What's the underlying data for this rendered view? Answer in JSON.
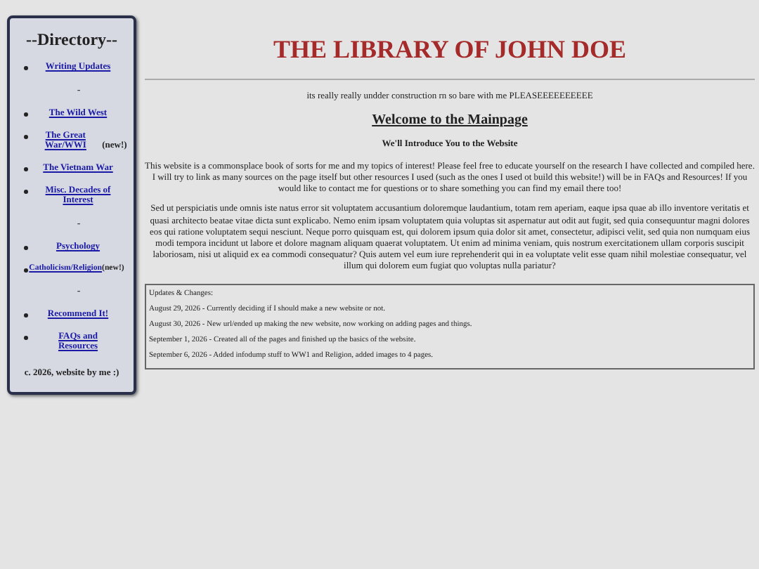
{
  "sidebar": {
    "title": "--Directory--",
    "items": [
      {
        "kind": "link",
        "label": "Writing Updates"
      },
      {
        "kind": "separator",
        "label": "-"
      },
      {
        "kind": "link",
        "label": "The Wild West"
      },
      {
        "kind": "link",
        "label": "The Great War/WWI",
        "note": "(new!)"
      },
      {
        "kind": "link",
        "label": "The Vietnam War"
      },
      {
        "kind": "link",
        "label": "Misc. Decades of Interest"
      },
      {
        "kind": "separator",
        "label": "-"
      },
      {
        "kind": "link",
        "label": "Psychology"
      },
      {
        "kind": "link",
        "label": "Catholicism/Religion",
        "note": "(new!)"
      },
      {
        "kind": "separator",
        "label": "-"
      },
      {
        "kind": "link",
        "label": "Recommend It!"
      },
      {
        "kind": "link",
        "label": "FAQs and Resources"
      }
    ],
    "footer": "c. 2026, website by me :)"
  },
  "main": {
    "title": "THE LIBRARY OF JOHN DOE",
    "notice": "its really really undder construction rn so bare with me PLEASEEEEEEEEEE",
    "heading": "Welcome to the Mainpage",
    "subheading": "We'll Introduce You to the Website",
    "paragraphs": [
      "This website is a commonsplace book of sorts for me and my topics of interest! Please feel free to educate yourself on the research I have collected and compiled here. I will try to link as many sources on the page itself but other resources I used (such as the ones I used ot build this website!) will be in FAQs and Resources! If you would like to contact me for questions or to share something you can find my email there too!",
      "Sed ut perspiciatis unde omnis iste natus error sit voluptatem accusantium doloremque laudantium, totam rem aperiam, eaque ipsa quae ab illo inventore veritatis et quasi architecto beatae vitae dicta sunt explicabo. Nemo enim ipsam voluptatem quia voluptas sit aspernatur aut odit aut fugit, sed quia consequuntur magni dolores eos qui ratione voluptatem sequi nesciunt. Neque porro quisquam est, qui dolorem ipsum quia dolor sit amet, consectetur, adipisci velit, sed quia non numquam eius modi tempora incidunt ut labore et dolore magnam aliquam quaerat voluptatem. Ut enim ad minima veniam, quis nostrum exercitationem ullam corporis suscipit laboriosam, nisi ut aliquid ex ea commodi consequatur? Quis autem vel eum iure reprehenderit qui in ea voluptate velit esse quam nihil molestiae consequatur, vel illum qui dolorem eum fugiat quo voluptas nulla pariatur?"
    ],
    "updates": {
      "title": "Updates & Changes:",
      "entries": [
        "August 29, 2026 - Currently deciding if I should make a new website or not.",
        "August 30, 2026 - New url/ended up making the new website, now working on adding pages and things.",
        "September 1, 2026 - Created all of the pages and finished up the basics of the website.",
        "September 6, 2026 - Added infodump stuff to WW1 and Religion, added images to 4 pages."
      ]
    }
  }
}
